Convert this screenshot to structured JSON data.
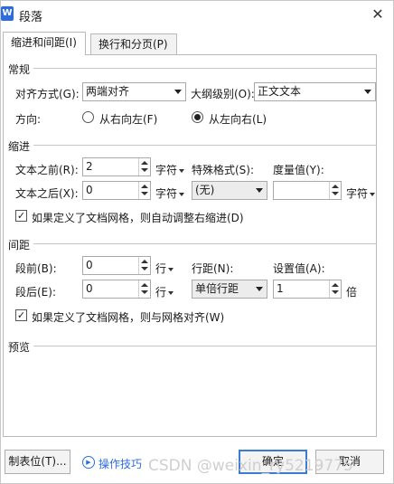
{
  "window": {
    "title": "段落",
    "icon_letter": "W"
  },
  "tabs": [
    {
      "label": "缩进和间距(I)",
      "active": true
    },
    {
      "label": "换行和分页(P)",
      "active": false
    }
  ],
  "general": {
    "section": "常规",
    "align_label": "对齐方式(G):",
    "align_value": "两端对齐",
    "outline_label": "大纲级别(O):",
    "outline_value": "正文文本",
    "direction_label": "方向:",
    "rtl_label": "从右向左(F)",
    "ltr_label": "从左向右(L)",
    "direction_selected": "ltr"
  },
  "indent": {
    "section": "缩进",
    "before_label": "文本之前(R):",
    "before_value": "2",
    "before_unit": "字符",
    "after_label": "文本之后(X):",
    "after_value": "0",
    "after_unit": "字符",
    "special_label": "特殊格式(S):",
    "special_value": "(无)",
    "measure_label": "度量值(Y):",
    "measure_value": "",
    "measure_unit": "字符",
    "grid_check_label": "如果定义了文档网格，则自动调整右缩进(D)",
    "grid_checked": true
  },
  "spacing": {
    "section": "间距",
    "before_label": "段前(B):",
    "before_value": "0",
    "before_unit": "行",
    "after_label": "段后(E):",
    "after_value": "0",
    "after_unit": "行",
    "line_label": "行距(N):",
    "line_value": "单倍行距",
    "setting_label": "设置值(A):",
    "setting_value": "1",
    "setting_unit": "倍",
    "grid_check_label": "如果定义了文档网格，则与网格对齐(W)",
    "grid_checked": true
  },
  "preview": {
    "section": "预览"
  },
  "footer": {
    "tabs_button": "制表位(T)...",
    "tips_link": "操作技巧",
    "ok_button": "确定",
    "cancel_button": "取消"
  },
  "watermark": "CSDN @weixin_ry5219775",
  "colors": {
    "accent": "#2b6de0",
    "primary_border": "#3a7bd5"
  }
}
